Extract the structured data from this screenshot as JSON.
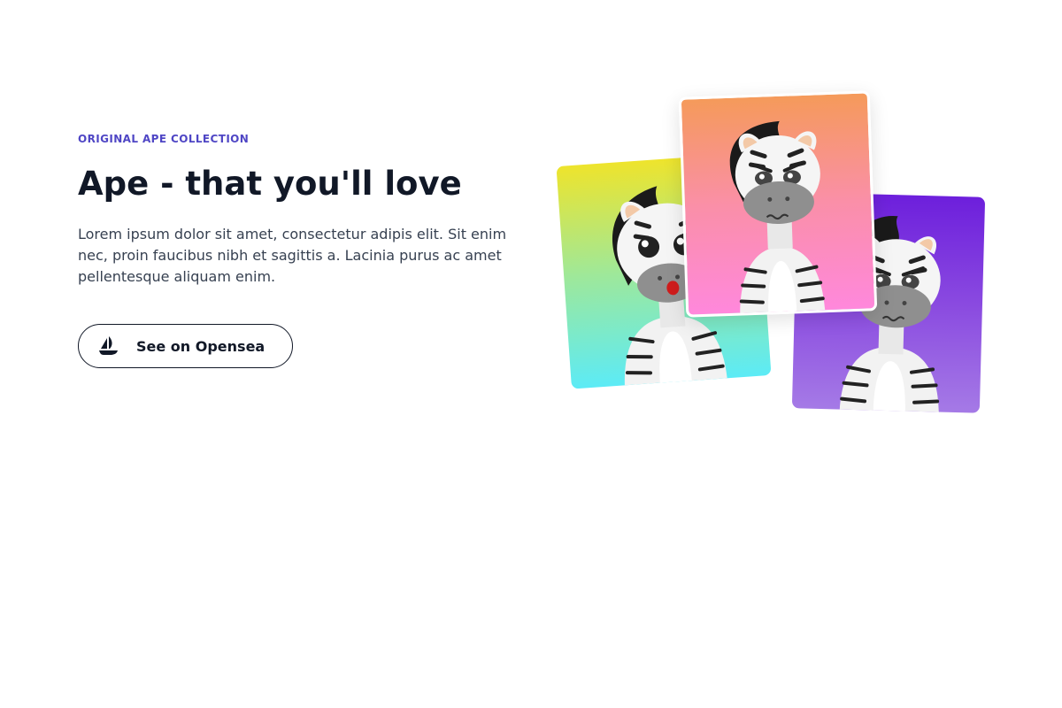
{
  "hero": {
    "eyebrow": "ORIGINAL APE COLLECTION",
    "title": "Ape - that you'll love",
    "description": "Lorem ipsum dolor sit amet, consectetur adipis elit. Sit enim nec, proin faucibus nibh et sagittis a. Lacinia purus ac amet pellentesque aliquam enim.",
    "cta": {
      "label": "See on Opensea",
      "icon": "opensea-ship-icon"
    }
  },
  "gallery": {
    "cards": [
      {
        "name": "zebra-card-surprised",
        "expression": "surprised",
        "gradient": [
          "#eee42c",
          "#5cebf6"
        ]
      },
      {
        "name": "zebra-card-angry",
        "expression": "angry",
        "gradient": [
          "#f59a5a",
          "#ff88dc"
        ]
      },
      {
        "name": "zebra-card-grumpy",
        "expression": "grumpy",
        "gradient": [
          "#6d1fdc",
          "#a57ae6"
        ]
      }
    ]
  },
  "colors": {
    "accent": "#4f46c5",
    "heading": "#111827",
    "body_text": "#374151"
  }
}
